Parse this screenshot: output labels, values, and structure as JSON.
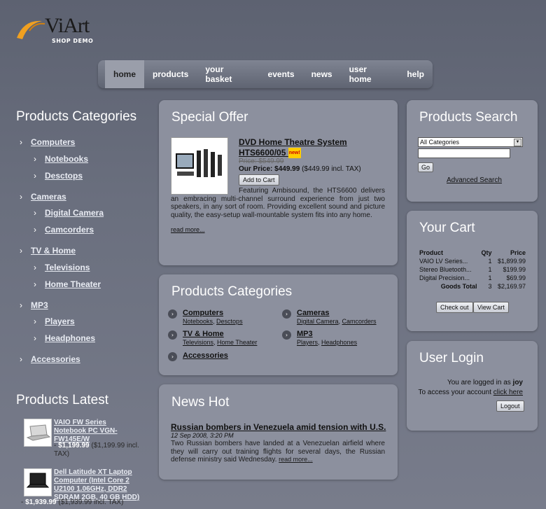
{
  "logo": {
    "name": "ViArt",
    "sub": "SHOP DEMO"
  },
  "nav": {
    "items": [
      {
        "label": "home"
      },
      {
        "label": "products"
      },
      {
        "label": "your basket"
      },
      {
        "label": "events"
      },
      {
        "label": "news"
      },
      {
        "label": "user home"
      },
      {
        "label": "help"
      }
    ]
  },
  "left": {
    "categories_title": "Products  Categories",
    "categories": [
      {
        "label": "Computers"
      },
      {
        "label": "Notebooks"
      },
      {
        "label": "Desctops"
      },
      {
        "label": "Cameras"
      },
      {
        "label": "Digital Camera"
      },
      {
        "label": "Camcorders"
      },
      {
        "label": "TV & Home"
      },
      {
        "label": "Televisions"
      },
      {
        "label": "Home Theater"
      },
      {
        "label": "MP3"
      },
      {
        "label": "Players"
      },
      {
        "label": "Headphones"
      },
      {
        "label": "Accessories"
      }
    ],
    "latest_title": "Products  Latest",
    "latest": [
      {
        "name": "VAIO FW Series Notebook PC VGN-FW145E/W",
        "price": "$1,199.99",
        "incl": "($1,199.99 incl. TAX)"
      },
      {
        "name": "Dell Latitude XT Laptop Computer (Intel Core 2 U2100 1.06GHz, DDR2 SDRAM 2GB, 40 GB HDD)",
        "price": "$1,939.99",
        "incl": "($1,939.99 incl. TAX)"
      }
    ]
  },
  "special": {
    "title": "Special Offer",
    "product": "DVD Home Theatre System HTS6600/05",
    "badge": "new!",
    "old_price": "Price: $549.99",
    "our_label": "Our Price:",
    "our_price": "$449.99",
    "incl": "($449.99 incl. TAX)",
    "add": "Add to Cart",
    "desc": "Featuring Ambisound, the HTS6600 delivers an embracing multi-channel surround experience from just two speakers, in any sort of room. Providing excellent sound and picture quality, the easy-setup wall-mountable system fits into any home.",
    "more": "read more..."
  },
  "cats": {
    "title": "Products  Categories",
    "c1": {
      "title": "Computers",
      "s1": "Notebooks",
      "s2": "Desctops"
    },
    "c2": {
      "title": "Cameras",
      "s1": "Digital Camera",
      "s2": "Camcorders"
    },
    "c3": {
      "title": "TV & Home",
      "s1": "Televisions",
      "s2": "Home Theater"
    },
    "c4": {
      "title": "MP3",
      "s1": "Players",
      "s2": "Headphones"
    },
    "c5": {
      "title": "Accessories"
    }
  },
  "news": {
    "title": "News  Hot",
    "headline": "Russian bombers in Venezuela amid tension with U.S.",
    "date": "12 Sep 2008, 3:20 PM",
    "text": "Two Russian bombers have landed at a Venezuelan airfield where they will carry out training flights for several days, the Russian defense ministry said Wednesday.",
    "more": "read more..."
  },
  "search": {
    "title": "Products  Search",
    "select": "All Categories",
    "go": "Go",
    "advanced": "Advanced Search"
  },
  "cart": {
    "title": "Your Cart",
    "h_product": "Product",
    "h_qty": "Qty",
    "h_price": "Price",
    "rows": [
      {
        "product": "VAIO LV Series...",
        "qty": "1",
        "price": "$1,899.99"
      },
      {
        "product": "Stereo Bluetooth...",
        "qty": "1",
        "price": "$199.99"
      },
      {
        "product": "Digital Precision...",
        "qty": "1",
        "price": "$69.99"
      }
    ],
    "total_label": "Goods Total",
    "total_qty": "3",
    "total_price": "$2,169.97",
    "checkout": "Check out",
    "view": "View Cart"
  },
  "login": {
    "title": "User Login",
    "logged_prefix": "You are logged in as",
    "user": "joy",
    "account_prefix": "To access your account",
    "click": "click here",
    "logout": "Logout"
  }
}
